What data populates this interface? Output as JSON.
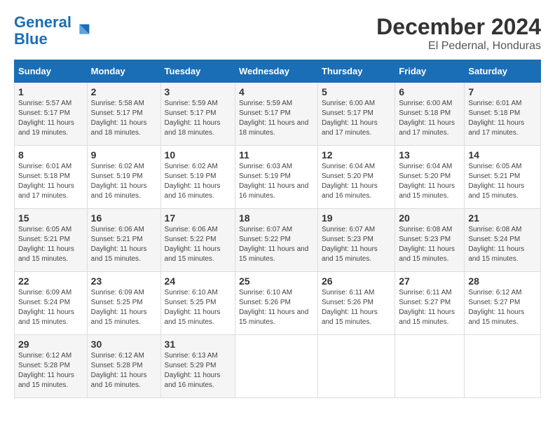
{
  "header": {
    "logo_line1": "General",
    "logo_line2": "Blue",
    "month": "December 2024",
    "location": "El Pedernal, Honduras"
  },
  "days_of_week": [
    "Sunday",
    "Monday",
    "Tuesday",
    "Wednesday",
    "Thursday",
    "Friday",
    "Saturday"
  ],
  "weeks": [
    [
      {
        "day": "1",
        "sunrise": "5:57 AM",
        "sunset": "5:17 PM",
        "daylight": "11 hours and 19 minutes."
      },
      {
        "day": "2",
        "sunrise": "5:58 AM",
        "sunset": "5:17 PM",
        "daylight": "11 hours and 18 minutes."
      },
      {
        "day": "3",
        "sunrise": "5:59 AM",
        "sunset": "5:17 PM",
        "daylight": "11 hours and 18 minutes."
      },
      {
        "day": "4",
        "sunrise": "5:59 AM",
        "sunset": "5:17 PM",
        "daylight": "11 hours and 18 minutes."
      },
      {
        "day": "5",
        "sunrise": "6:00 AM",
        "sunset": "5:17 PM",
        "daylight": "11 hours and 17 minutes."
      },
      {
        "day": "6",
        "sunrise": "6:00 AM",
        "sunset": "5:18 PM",
        "daylight": "11 hours and 17 minutes."
      },
      {
        "day": "7",
        "sunrise": "6:01 AM",
        "sunset": "5:18 PM",
        "daylight": "11 hours and 17 minutes."
      }
    ],
    [
      {
        "day": "8",
        "sunrise": "6:01 AM",
        "sunset": "5:18 PM",
        "daylight": "11 hours and 17 minutes."
      },
      {
        "day": "9",
        "sunrise": "6:02 AM",
        "sunset": "5:19 PM",
        "daylight": "11 hours and 16 minutes."
      },
      {
        "day": "10",
        "sunrise": "6:02 AM",
        "sunset": "5:19 PM",
        "daylight": "11 hours and 16 minutes."
      },
      {
        "day": "11",
        "sunrise": "6:03 AM",
        "sunset": "5:19 PM",
        "daylight": "11 hours and 16 minutes."
      },
      {
        "day": "12",
        "sunrise": "6:04 AM",
        "sunset": "5:20 PM",
        "daylight": "11 hours and 16 minutes."
      },
      {
        "day": "13",
        "sunrise": "6:04 AM",
        "sunset": "5:20 PM",
        "daylight": "11 hours and 15 minutes."
      },
      {
        "day": "14",
        "sunrise": "6:05 AM",
        "sunset": "5:21 PM",
        "daylight": "11 hours and 15 minutes."
      }
    ],
    [
      {
        "day": "15",
        "sunrise": "6:05 AM",
        "sunset": "5:21 PM",
        "daylight": "11 hours and 15 minutes."
      },
      {
        "day": "16",
        "sunrise": "6:06 AM",
        "sunset": "5:21 PM",
        "daylight": "11 hours and 15 minutes."
      },
      {
        "day": "17",
        "sunrise": "6:06 AM",
        "sunset": "5:22 PM",
        "daylight": "11 hours and 15 minutes."
      },
      {
        "day": "18",
        "sunrise": "6:07 AM",
        "sunset": "5:22 PM",
        "daylight": "11 hours and 15 minutes."
      },
      {
        "day": "19",
        "sunrise": "6:07 AM",
        "sunset": "5:23 PM",
        "daylight": "11 hours and 15 minutes."
      },
      {
        "day": "20",
        "sunrise": "6:08 AM",
        "sunset": "5:23 PM",
        "daylight": "11 hours and 15 minutes."
      },
      {
        "day": "21",
        "sunrise": "6:08 AM",
        "sunset": "5:24 PM",
        "daylight": "11 hours and 15 minutes."
      }
    ],
    [
      {
        "day": "22",
        "sunrise": "6:09 AM",
        "sunset": "5:24 PM",
        "daylight": "11 hours and 15 minutes."
      },
      {
        "day": "23",
        "sunrise": "6:09 AM",
        "sunset": "5:25 PM",
        "daylight": "11 hours and 15 minutes."
      },
      {
        "day": "24",
        "sunrise": "6:10 AM",
        "sunset": "5:25 PM",
        "daylight": "11 hours and 15 minutes."
      },
      {
        "day": "25",
        "sunrise": "6:10 AM",
        "sunset": "5:26 PM",
        "daylight": "11 hours and 15 minutes."
      },
      {
        "day": "26",
        "sunrise": "6:11 AM",
        "sunset": "5:26 PM",
        "daylight": "11 hours and 15 minutes."
      },
      {
        "day": "27",
        "sunrise": "6:11 AM",
        "sunset": "5:27 PM",
        "daylight": "11 hours and 15 minutes."
      },
      {
        "day": "28",
        "sunrise": "6:12 AM",
        "sunset": "5:27 PM",
        "daylight": "11 hours and 15 minutes."
      }
    ],
    [
      {
        "day": "29",
        "sunrise": "6:12 AM",
        "sunset": "5:28 PM",
        "daylight": "11 hours and 15 minutes."
      },
      {
        "day": "30",
        "sunrise": "6:12 AM",
        "sunset": "5:28 PM",
        "daylight": "11 hours and 16 minutes."
      },
      {
        "day": "31",
        "sunrise": "6:13 AM",
        "sunset": "5:29 PM",
        "daylight": "11 hours and 16 minutes."
      },
      null,
      null,
      null,
      null
    ]
  ]
}
